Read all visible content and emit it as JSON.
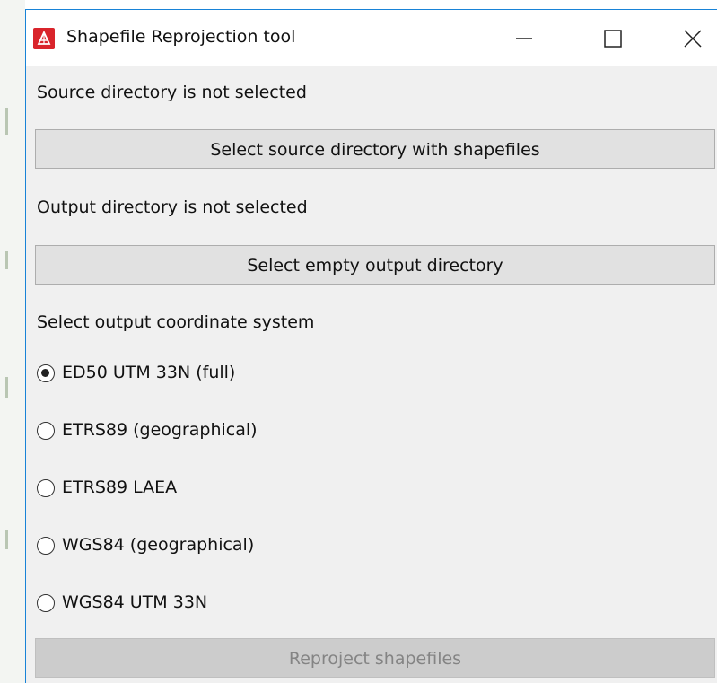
{
  "window": {
    "title": "Shapefile Reprojection tool",
    "controls": {
      "minimize": "minimize-icon",
      "maximize": "maximize-icon",
      "close": "close-icon"
    }
  },
  "source": {
    "status": "Source directory is not selected",
    "button_label": "Select source directory with shapefiles"
  },
  "output": {
    "status": "Output directory is not selected",
    "button_label": "Select empty output directory"
  },
  "crs": {
    "heading": "Select output coordinate system",
    "options": [
      {
        "label": "ED50 UTM 33N (full)",
        "checked": true
      },
      {
        "label": "ETRS89 (geographical)",
        "checked": false
      },
      {
        "label": "ETRS89 LAEA",
        "checked": false
      },
      {
        "label": "WGS84 (geographical)",
        "checked": false
      },
      {
        "label": "WGS84 UTM 33N",
        "checked": false
      }
    ]
  },
  "actions": {
    "reproject_label": "Reproject shapefiles",
    "reproject_enabled": false
  },
  "colors": {
    "accent_border": "#1883d7",
    "app_icon": "#d9242b"
  }
}
